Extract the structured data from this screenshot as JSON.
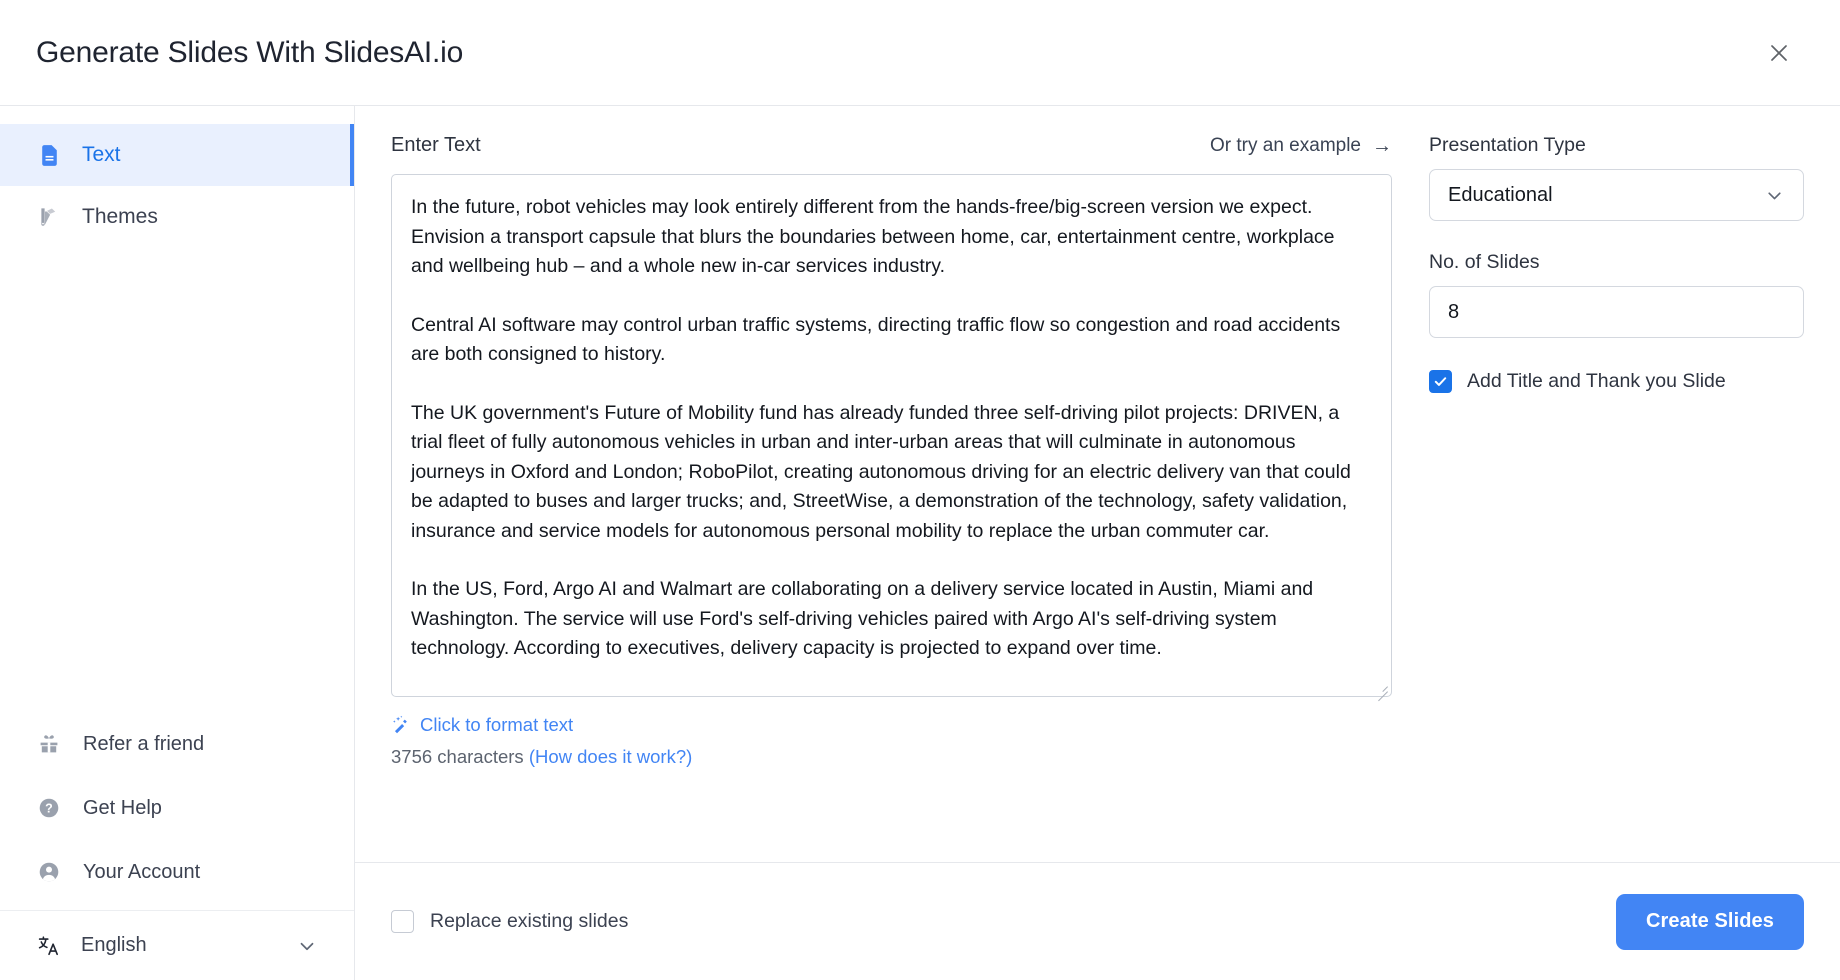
{
  "header": {
    "title": "Generate Slides With SlidesAI.io",
    "close_icon": "close-icon"
  },
  "sidebar": {
    "top_items": [
      {
        "label": "Text",
        "icon": "document-icon",
        "active": true
      },
      {
        "label": "Themes",
        "icon": "palette-icon",
        "active": false
      }
    ],
    "bottom_items": [
      {
        "label": "Refer a friend",
        "icon": "gift-icon"
      },
      {
        "label": "Get Help",
        "icon": "question-circle-icon"
      },
      {
        "label": "Your Account",
        "icon": "user-circle-icon"
      }
    ],
    "language": {
      "label": "English",
      "icon": "translate-icon",
      "chevron": "chevron-down-icon"
    }
  },
  "editor": {
    "label": "Enter Text",
    "example_link": "Or try an example",
    "example_arrow": "→",
    "text_paragraphs": [
      "In the future, robot vehicles may look entirely different from the hands-free/big-screen version we expect. Envision a transport capsule that blurs the boundaries between home, car, entertainment centre, workplace and wellbeing hub – and a whole new in-car services industry.",
      "Central AI software may control urban traffic systems, directing traffic flow so congestion and road accidents are both consigned to history.",
      "The UK government's Future of Mobility fund has already funded three self-driving pilot projects: DRIVEN, a trial fleet of fully autonomous vehicles in urban and inter-urban areas that will culminate in autonomous journeys in Oxford and London; RoboPilot, creating autonomous driving for an electric delivery van that could be adapted to buses and larger trucks; and, StreetWise, a demonstration of the technology, safety validation, insurance and service models for autonomous personal mobility to replace the urban commuter car.",
      "In the US, Ford, Argo AI and Walmart are collaborating on a delivery service located in Austin, Miami and Washington. The service will use Ford's self-driving vehicles paired with Argo AI's self-driving system technology. According to executives, delivery capacity is projected to expand over time."
    ],
    "format_link": "Click to format text",
    "format_icon": "magic-wand-icon",
    "character_count": "3756 characters",
    "how_link": "(How does it work?)"
  },
  "options": {
    "presentation_type_label": "Presentation Type",
    "presentation_type_value": "Educational",
    "slides_label": "No. of Slides",
    "slides_value": "8",
    "add_title_label": "Add Title and Thank you Slide",
    "add_title_checked": true
  },
  "footer": {
    "replace_label": "Replace existing slides",
    "replace_checked": false,
    "create_button": "Create Slides"
  },
  "colors": {
    "accent": "#4285f4",
    "accent_dark": "#1a73e8",
    "active_bg": "#e9f0fe",
    "text": "#2e3440",
    "muted": "#5c636f",
    "border": "#d4d8df"
  }
}
